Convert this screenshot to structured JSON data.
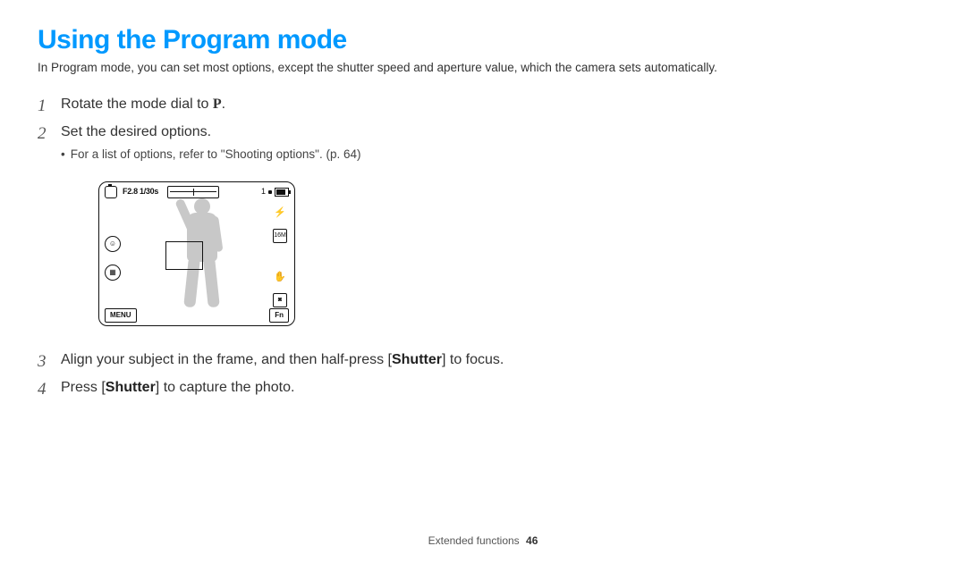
{
  "title": "Using the Program mode",
  "intro": "In Program mode, you can set most options, except the shutter speed and aperture value, which the camera sets automatically.",
  "steps": [
    {
      "num": "1",
      "pre": "Rotate the mode dial to ",
      "icon": "P",
      "post": "."
    },
    {
      "num": "2",
      "pre": "Set the desired options.",
      "sub_pre": "For a list of options, refer to \"Shooting options\". (p. 64)"
    },
    {
      "num": "3",
      "pre": "Align your subject in the frame, and then half-press [",
      "bold": "Shutter",
      "post": "] to focus."
    },
    {
      "num": "4",
      "pre": "Press [",
      "bold": "Shutter",
      "post": "] to capture the photo."
    }
  ],
  "screen": {
    "exposure": "F2.8 1/30s",
    "count": "1",
    "menu": "MENU",
    "fn": "Fn"
  },
  "footer": {
    "section": "Extended functions",
    "page": "46"
  }
}
